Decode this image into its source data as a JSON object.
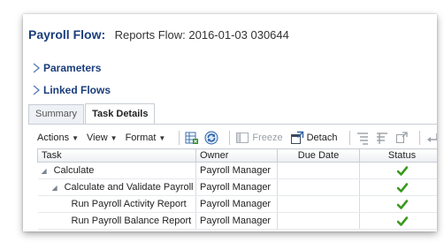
{
  "page": {
    "title_label": "Payroll Flow:",
    "title_value": "Reports Flow: 2016-01-03  030644"
  },
  "sections": {
    "parameters": "Parameters",
    "linked_flows": "Linked Flows"
  },
  "tabs": [
    {
      "label": "Summary",
      "active": false
    },
    {
      "label": "Task Details",
      "active": true
    }
  ],
  "toolbar": {
    "actions": "Actions",
    "view": "View",
    "format": "Format",
    "freeze": "Freeze",
    "detach": "Detach",
    "wrap_partial": "W"
  },
  "table": {
    "columns": [
      "Task",
      "Owner",
      "Due Date",
      "Status"
    ],
    "rows": [
      {
        "task": "Calculate",
        "owner": "Payroll Manager",
        "due_date": "",
        "status": "completed",
        "level": 0,
        "expandable": true
      },
      {
        "task": "Calculate and Validate Payroll",
        "owner": "Payroll Manager",
        "due_date": "",
        "status": "completed",
        "level": 1,
        "expandable": true
      },
      {
        "task": "Run Payroll Activity Report",
        "owner": "Payroll Manager",
        "due_date": "",
        "status": "completed",
        "level": 2,
        "expandable": false
      },
      {
        "task": "Run Payroll Balance Report",
        "owner": "Payroll Manager",
        "due_date": "",
        "status": "completed",
        "level": 2,
        "expandable": false
      }
    ]
  },
  "colors": {
    "title_blue": "#1a3d7c",
    "check_green": "#3a9a1f"
  }
}
